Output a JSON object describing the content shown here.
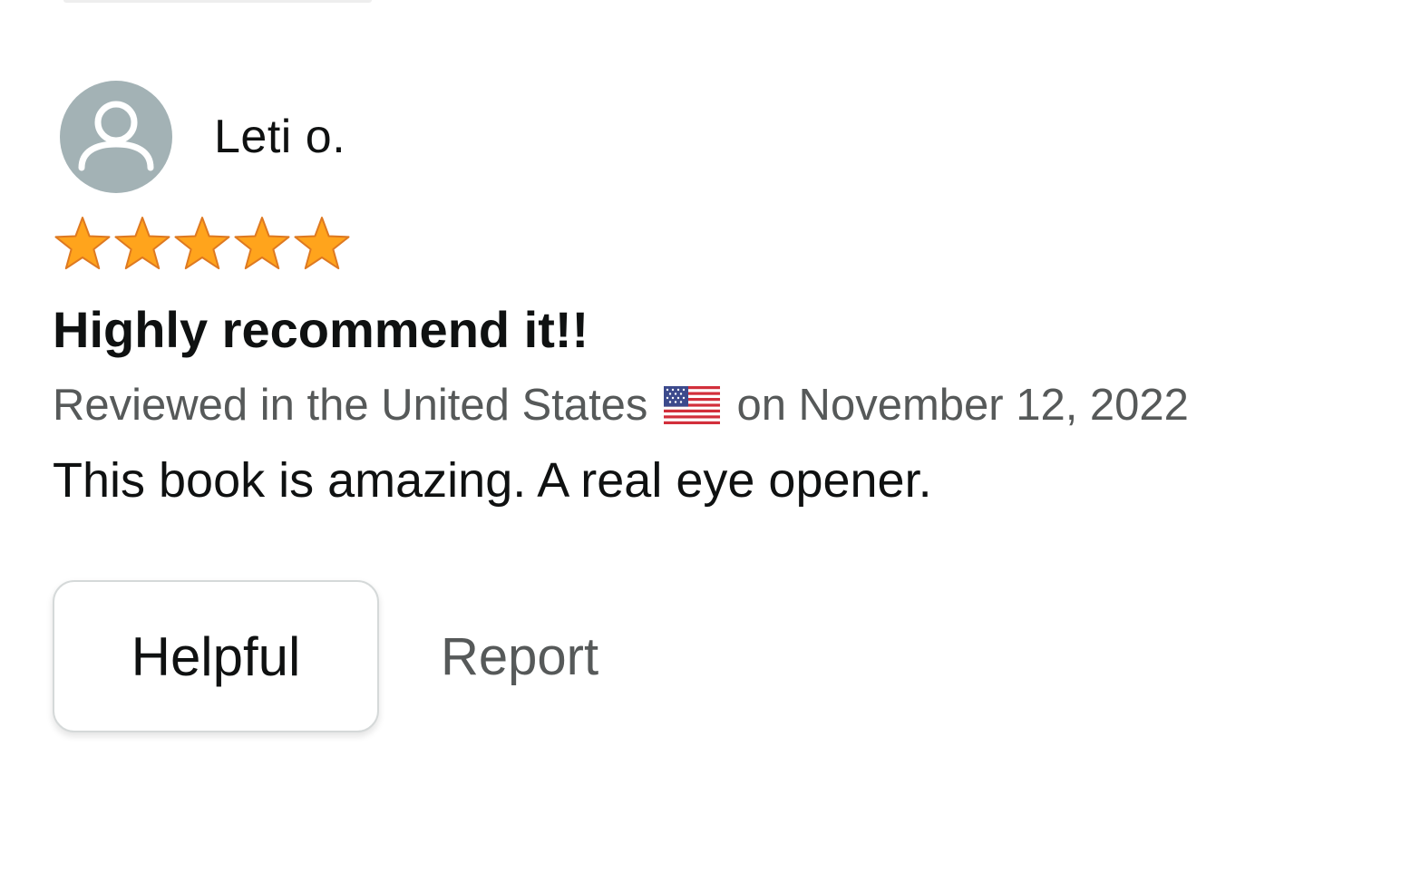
{
  "review": {
    "reviewer_name": "Leti o.",
    "rating": 5,
    "rating_max": 5,
    "star_color": "#ffa41c",
    "star_stroke": "#de7921",
    "title": "Highly recommend it!!",
    "reviewed_prefix": "Reviewed in the United States",
    "flag_icon": "us-flag-icon",
    "reviewed_suffix": "on November 12, 2022",
    "body": "This book is amazing. A real eye opener.",
    "actions": {
      "helpful_label": "Helpful",
      "report_label": "Report"
    }
  },
  "colors": {
    "avatar_bg": "#a3b2b5",
    "text_primary": "#0f1111",
    "text_secondary": "#565959"
  }
}
